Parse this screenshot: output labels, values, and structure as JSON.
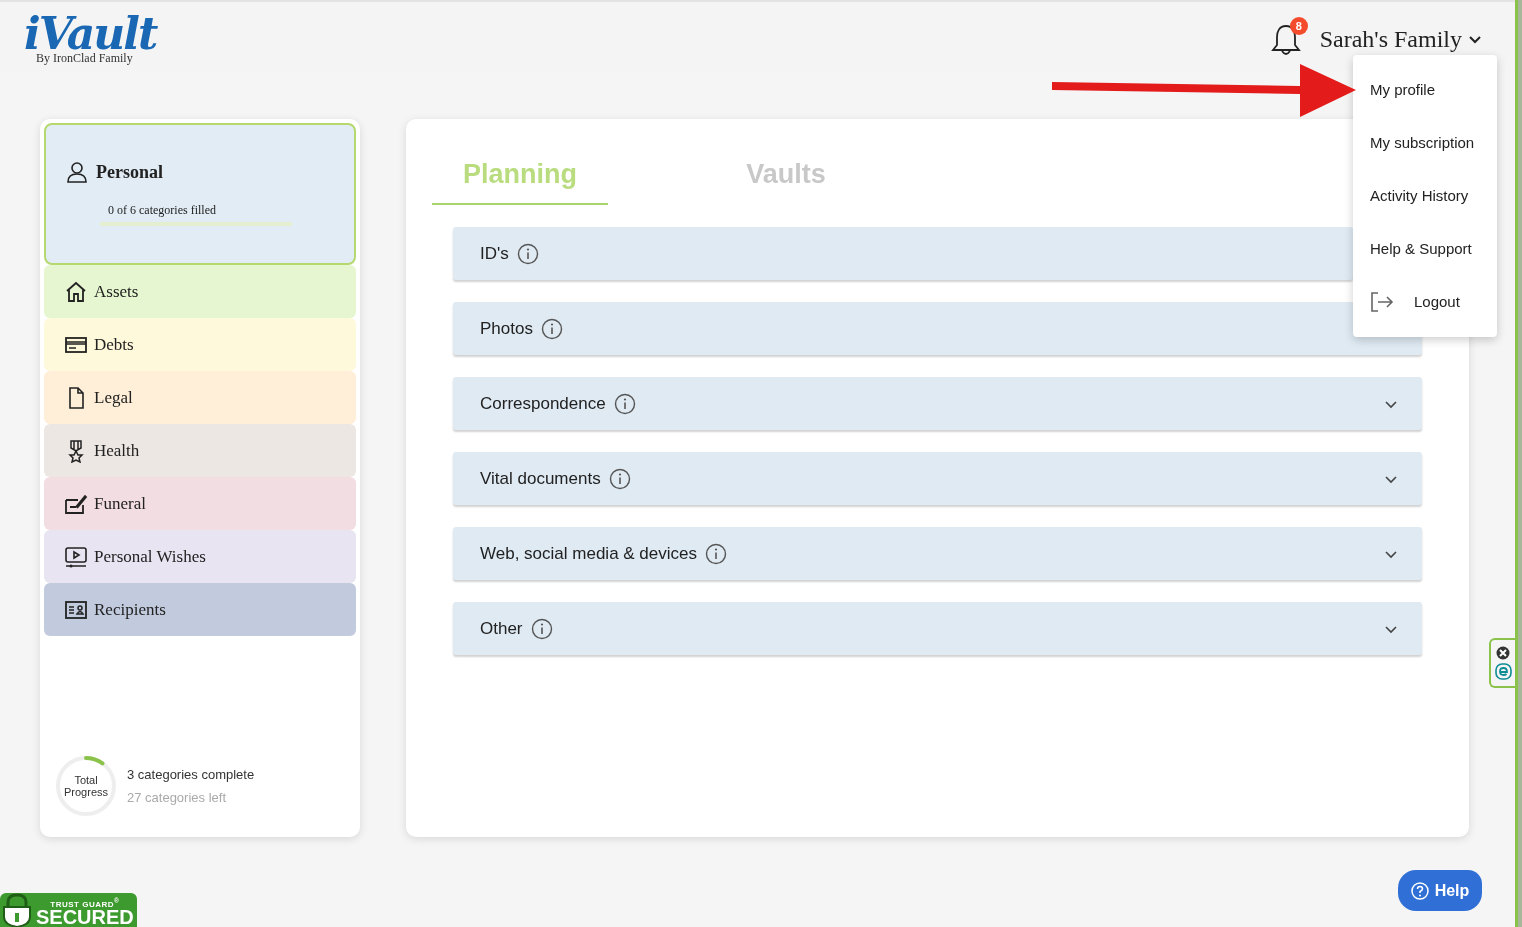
{
  "header": {
    "logo": {
      "title": "iVault",
      "subtitle": "By IronClad Family"
    },
    "notifications": {
      "count": "8"
    },
    "account": {
      "name": "Sarah's Family",
      "expanded": true
    }
  },
  "menu": {
    "items": [
      {
        "label": "My profile",
        "kind": "text"
      },
      {
        "label": "My subscription",
        "kind": "text"
      },
      {
        "label": "Activity History",
        "kind": "text"
      },
      {
        "label": "Help & Support",
        "kind": "text"
      },
      {
        "label": "Logout",
        "kind": "logout"
      }
    ]
  },
  "sidebar": {
    "summary": {
      "title": "Personal",
      "selected": true,
      "caption": "0 of 6 categories filled"
    },
    "items": [
      {
        "label": "Assets",
        "kind": "home",
        "color": "#e6f6d0"
      },
      {
        "label": "Debts",
        "kind": "card",
        "color": "#fff9dc"
      },
      {
        "label": "Legal",
        "kind": "document",
        "color": "#ffefd8"
      },
      {
        "label": "Health",
        "kind": "award",
        "color": "#ede7e4"
      },
      {
        "label": "Funeral",
        "kind": "edit",
        "color": "#f2dde2"
      },
      {
        "label": "Personal Wishes",
        "kind": "video",
        "color": "#e8e4f2"
      },
      {
        "label": "Recipients",
        "kind": "contact",
        "color": "#c2cade"
      }
    ],
    "progress": {
      "label": "Total Progress",
      "level": 0.1,
      "complete": "3 categories complete",
      "left": "27 categories left"
    }
  },
  "tabs": [
    {
      "label": "Planning",
      "selected": true
    },
    {
      "label": "Vaults",
      "selected": false
    }
  ],
  "sections": [
    {
      "label": "ID's"
    },
    {
      "label": "Photos"
    },
    {
      "label": "Correspondence",
      "expanded": false
    },
    {
      "label": "Vital documents",
      "expanded": false
    },
    {
      "label": "Web, social media & devices",
      "expanded": false
    },
    {
      "label": "Other",
      "expanded": false
    }
  ],
  "help": {
    "label": "Help"
  },
  "trust_badge": {
    "top": "TRUST GUARD$^{®}$",
    "bottom": "SECURED"
  }
}
